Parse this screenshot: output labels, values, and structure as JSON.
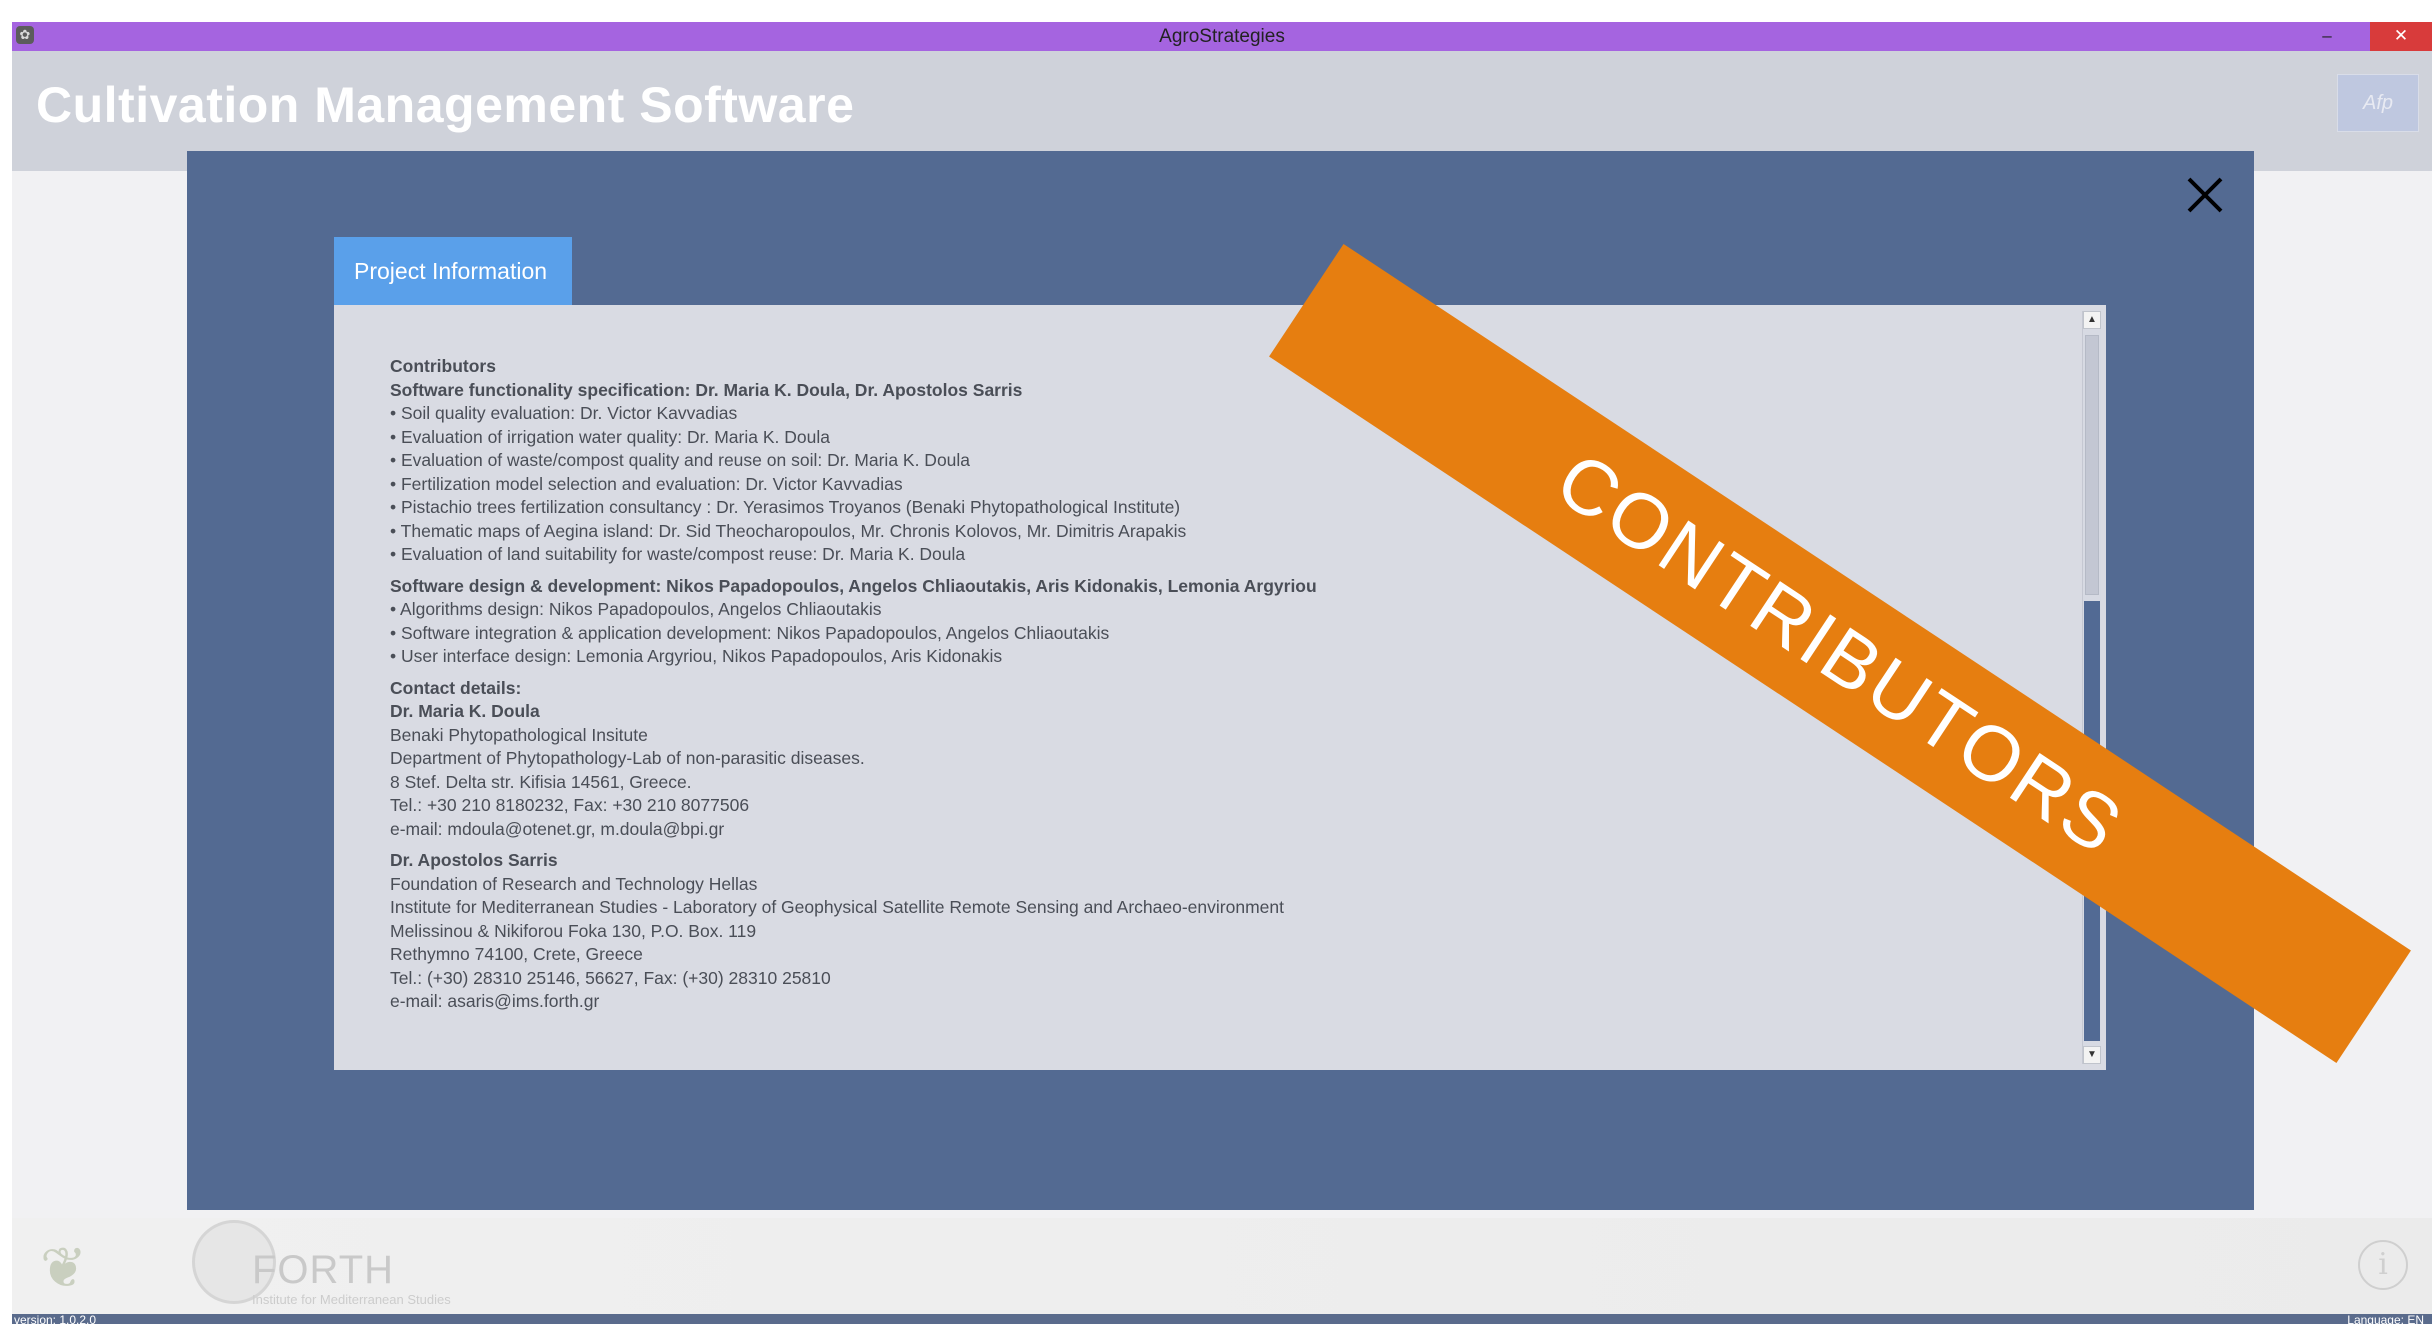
{
  "window": {
    "title": "AgroStrategies",
    "icon": "app-icon",
    "controls": {
      "minimize": "–",
      "maximize": "❐",
      "close": "✕"
    }
  },
  "header": {
    "app_title": "Cultivation Management Software",
    "eu_logo_text": "Afp"
  },
  "dialog": {
    "close_icon": "close-icon",
    "tab_label": "Project Information",
    "banner_text": "CONTRIBUTORS",
    "banner_color": "#e67e10",
    "content": {
      "heading": "Contributors",
      "spec_title": "Software functionality specification:  Dr. Maria K. Doula, Dr. Apostolos Sarris",
      "spec_items": [
        "• Soil quality evaluation:  Dr. Victor Kavvadias",
        "• Evaluation of irrigation water quality:  Dr. Maria K. Doula",
        "• Evaluation of waste/compost quality and reuse on soil:  Dr. Maria K. Doula",
        "• Fertilization model selection and evaluation: Dr. Victor Kavvadias",
        "• Pistachio trees fertilization consultancy : Dr. Yerasimos Troyanos (Benaki Phytopathological Institute)",
        "• Thematic maps of Aegina island:  Dr. Sid Theocharopoulos, Mr. Chronis Kolovos, Mr. Dimitris Arapakis",
        "• Evaluation of land suitability for waste/compost reuse:  Dr. Maria K. Doula"
      ],
      "design_title": "Software design & development: Nikos Papadopoulos, Angelos Chliaoutakis, Aris Kidonakis, Lemonia Argyriou",
      "design_items": [
        "• Algorithms design: Nikos Papadopoulos, Angelos Chliaoutakis",
        "• Software integration & application development: Nikos Papadopoulos, Angelos Chliaoutakis",
        "• User interface design: Lemonia Argyriou, Nikos Papadopoulos, Aris Kidonakis"
      ],
      "contact_title": "Contact details:",
      "contact1_name": "Dr. Maria K. Doula",
      "contact1_lines": [
        "Benaki Phytopathological Insitute",
        "Department of Phytopathology-Lab of non-parasitic diseases.",
        "8 Stef. Delta str. Kifisia 14561, Greece.",
        "Tel.: +30 210 8180232, Fax: +30 210 8077506",
        "e-mail: mdoula@otenet.gr, m.doula@bpi.gr"
      ],
      "contact2_name": "Dr. Apostolos Sarris",
      "contact2_lines": [
        "Foundation of Research and Technology Hellas",
        "Institute for Mediterranean Studies - Laboratory of Geophysical Satellite Remote Sensing and Archaeo-environment",
        "Melissinou & Nikiforou Foka 130, P.O. Box. 119",
        "Rethymno 74100, Crete, Greece",
        "Tel.: (+30) 28310 25146, 56627, Fax: (+30) 28310 25810",
        "e-mail: asaris@ims.forth.gr"
      ]
    }
  },
  "footer": {
    "forth_name": "FORTH",
    "forth_sub": "Institute for Mediterranean Studies",
    "info_icon": "i"
  },
  "status": {
    "version": "version: 1.0.2.0",
    "language": "Language: EN"
  }
}
